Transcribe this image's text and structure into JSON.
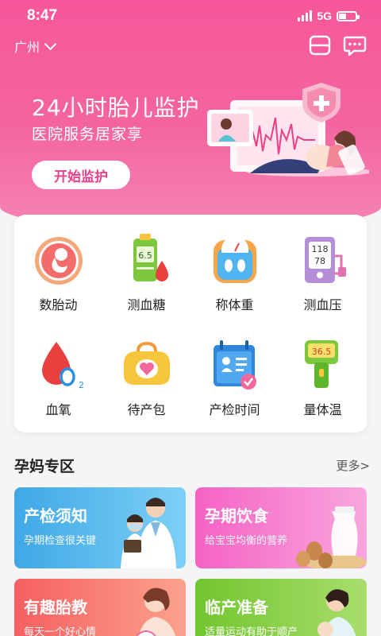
{
  "status": {
    "time": "8:47",
    "network": "5G"
  },
  "header": {
    "city": "广州"
  },
  "hero": {
    "title": "24小时胎儿监护",
    "subtitle": "医院服务居家享",
    "button": "开始监护"
  },
  "tools": [
    {
      "label": "数胎动",
      "icon": "fetus-icon"
    },
    {
      "label": "测血糖",
      "icon": "glucose-meter-icon"
    },
    {
      "label": "称体重",
      "icon": "scale-icon"
    },
    {
      "label": "测血压",
      "icon": "blood-pressure-icon"
    },
    {
      "label": "血氧",
      "icon": "blood-oxygen-icon"
    },
    {
      "label": "待产包",
      "icon": "maternity-bag-icon"
    },
    {
      "label": "产检时间",
      "icon": "checkup-calendar-icon"
    },
    {
      "label": "量体温",
      "icon": "thermometer-icon"
    }
  ],
  "tool_values": {
    "glucose": "6.5",
    "bp_top": "118",
    "bp_bottom": "78",
    "temp": "36.5",
    "oxygen_sub": "2"
  },
  "section": {
    "title": "孕妈专区",
    "more": "更多>",
    "cards": [
      {
        "title": "产检须知",
        "desc": "孕期检查很关键"
      },
      {
        "title": "孕期饮食",
        "desc": "给宝宝均衡的营养"
      },
      {
        "title": "有趣胎教",
        "desc": "每天一个好心情"
      },
      {
        "title": "临产准备",
        "desc": "适量运动有助于顺产"
      }
    ]
  },
  "colors": {
    "brand": "#f7579a",
    "blue_card": "#4db0e8",
    "pink_card": "#f578c8",
    "orange_card": "#f57670",
    "green_card": "#7fce3c"
  }
}
